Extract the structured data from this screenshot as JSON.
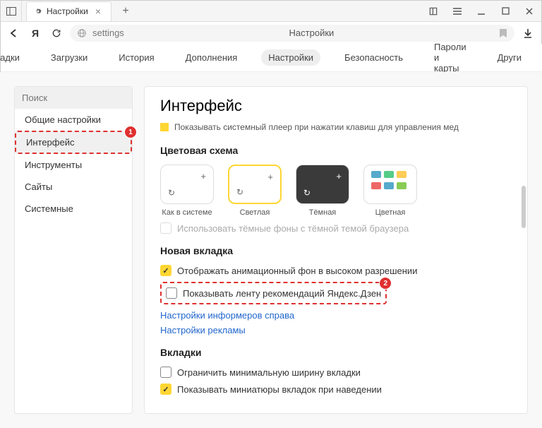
{
  "titlebar": {
    "tab_title": "Настройки"
  },
  "addressbar": {
    "url_text": "settings",
    "page_title": "Настройки"
  },
  "nav_tabs": {
    "bookmarks": "Закладки",
    "downloads": "Загрузки",
    "history": "История",
    "addons": "Дополнения",
    "settings": "Настройки",
    "security": "Безопасность",
    "passwords": "Пароли и карты",
    "other": "Други"
  },
  "sidebar": {
    "search_placeholder": "Поиск",
    "items": {
      "general": "Общие настройки",
      "interface": "Интерфейс",
      "tools": "Инструменты",
      "sites": "Сайты",
      "system": "Системные"
    }
  },
  "annotations": {
    "badge1": "1",
    "badge2": "2"
  },
  "page": {
    "heading": "Интерфейс",
    "truncated_option": "Показывать системный плеер при нажатии клавиш для управления мед",
    "color_scheme": {
      "title": "Цветовая схема",
      "system": "Как в системе",
      "light": "Светлая",
      "dark": "Тёмная",
      "color": "Цветная",
      "dark_bg_option": "Использовать тёмные фоны с тёмной темой браузера"
    },
    "new_tab": {
      "title": "Новая вкладка",
      "anim_bg": "Отображать анимационный фон в высоком разрешении",
      "zen_feed": "Показывать ленту рекомендаций Яндекс.Дзен",
      "informers_link": "Настройки информеров справа",
      "ads_link": "Настройки рекламы"
    },
    "tabs_section": {
      "title": "Вкладки",
      "min_width": "Ограничить минимальную ширину вкладки",
      "thumbnails": "Показывать миниатюры вкладок при наведении"
    }
  }
}
